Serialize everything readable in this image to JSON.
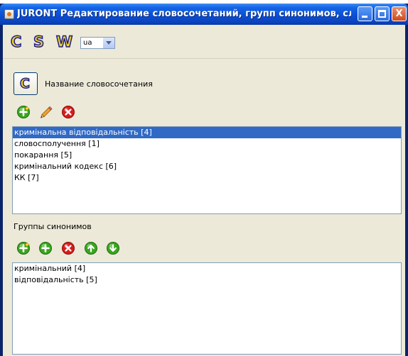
{
  "window": {
    "title": "JURONT Редактирование словосочетаний, групп синонимов, слов",
    "controls": {
      "minimize": "",
      "maximize": "",
      "close": "X"
    }
  },
  "toolbar": {
    "buttons": [
      "C",
      "S",
      "W"
    ],
    "language_select": {
      "value": "ua"
    }
  },
  "phrase_section": {
    "button_label": "C",
    "title": "Название словосочетания",
    "actions": [
      "add-icon",
      "edit-pencil-icon",
      "delete-icon"
    ],
    "items": [
      {
        "text": "кримінальна відповідальність [4]",
        "selected": true
      },
      {
        "text": "словосполучення [1]",
        "selected": false
      },
      {
        "text": "покарання [5]",
        "selected": false
      },
      {
        "text": "кримінальний кодекс [6]",
        "selected": false
      },
      {
        "text": "КК [7]",
        "selected": false
      }
    ]
  },
  "synonym_section": {
    "title": "Группы синонимов",
    "actions": [
      "add-new-icon",
      "add-icon",
      "delete-icon",
      "move-up-icon",
      "move-down-icon"
    ],
    "items": [
      {
        "text": "кримінальний [4]"
      },
      {
        "text": "відповідальність [5]"
      }
    ]
  },
  "colors": {
    "selection": "#316ac5",
    "titlebar": "#0a4fd6",
    "window_bg": "#ece9d8",
    "list_border": "#7f9db9",
    "green_icon": "#3aa51f",
    "red_icon": "#d71b1b"
  }
}
